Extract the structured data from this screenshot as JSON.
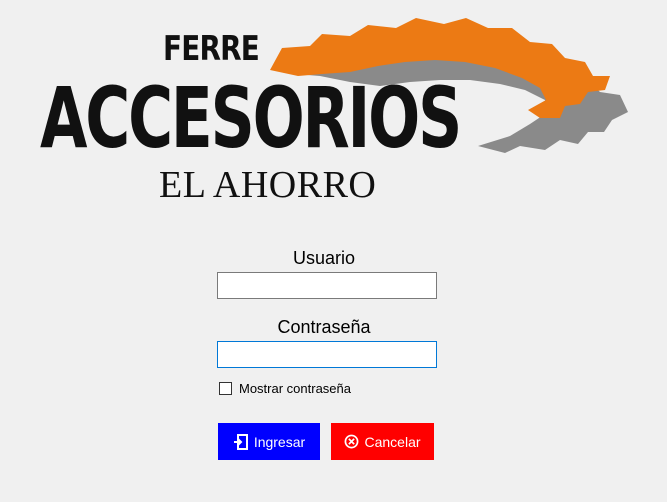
{
  "logo": {
    "line1": "FERRE",
    "line2": "ACCESORIOS",
    "line3": "EL AHORRO",
    "gear_colors": {
      "front": "#ec7a14",
      "back": "#8a8a8a"
    }
  },
  "form": {
    "usuario_label": "Usuario",
    "usuario_value": "",
    "password_label": "Contraseña",
    "password_value": "",
    "show_password_label": "Mostrar contraseña",
    "show_password_checked": false
  },
  "buttons": {
    "ingresar": {
      "label": "Ingresar",
      "icon": "door-enter-icon",
      "color": "#0000ff"
    },
    "cancelar": {
      "label": "Cancelar",
      "icon": "cancel-circle-icon",
      "color": "#ff0000"
    }
  }
}
